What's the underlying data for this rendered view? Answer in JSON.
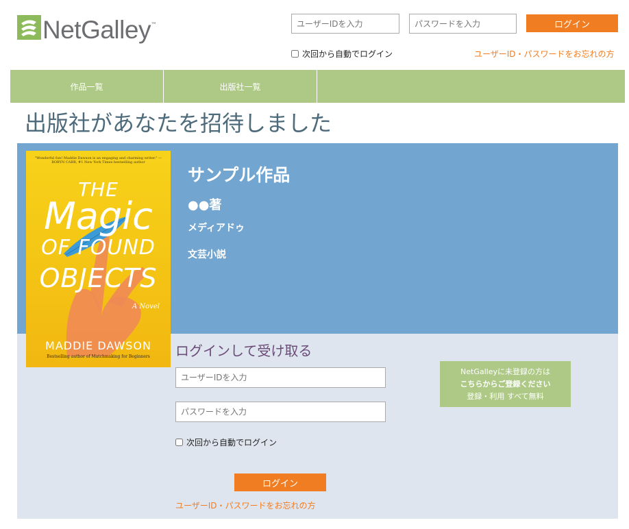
{
  "brand": {
    "name": "NetGalley",
    "tm": "™",
    "colors": {
      "orange": "#f07d22",
      "green": "#adc985",
      "blue": "#72a5cf",
      "lightblue": "#dfe5ee"
    }
  },
  "header": {
    "user_placeholder": "ユーザーIDを入力",
    "password_placeholder": "パスワードを入力",
    "login_label": "ログイン",
    "remember_label": "次回から自動でログイン",
    "forgot_label": "ユーザーID・パスワードをお忘れの方"
  },
  "nav": {
    "items": [
      {
        "label": "作品一覧"
      },
      {
        "label": "出版社一覧"
      }
    ]
  },
  "page": {
    "title": "出版社があなたを招待しました"
  },
  "book": {
    "title": "サンプル作品",
    "author": "●●著",
    "publisher": "メディアドゥ",
    "genre": "文芸小説",
    "cover": {
      "quote": "\"Wonderful fun! Maddie Dawson is an engaging and charming writer.\" —ROBYN CARR, #1 New York Times bestselling author",
      "title_line1": "THE",
      "title_line2": "Magic",
      "title_line3": "OF FOUND",
      "title_line4": "OBJECTS",
      "subtitle": "A Novel",
      "author": "MADDIE DAWSON",
      "tagline": "Bestselling author of Matchmaking for Beginners"
    }
  },
  "login": {
    "heading": "ログインして受け取る",
    "user_placeholder": "ユーザーIDを入力",
    "password_placeholder": "パスワードを入力",
    "remember_label": "次回から自動でログイン",
    "login_label": "ログイン",
    "forgot_label": "ユーザーID・パスワードをお忘れの方"
  },
  "register": {
    "line1": "NetGalleyに未登録の方は",
    "line2": "こちらからご登録ください",
    "line3": "登録・利用 すべて無料"
  }
}
